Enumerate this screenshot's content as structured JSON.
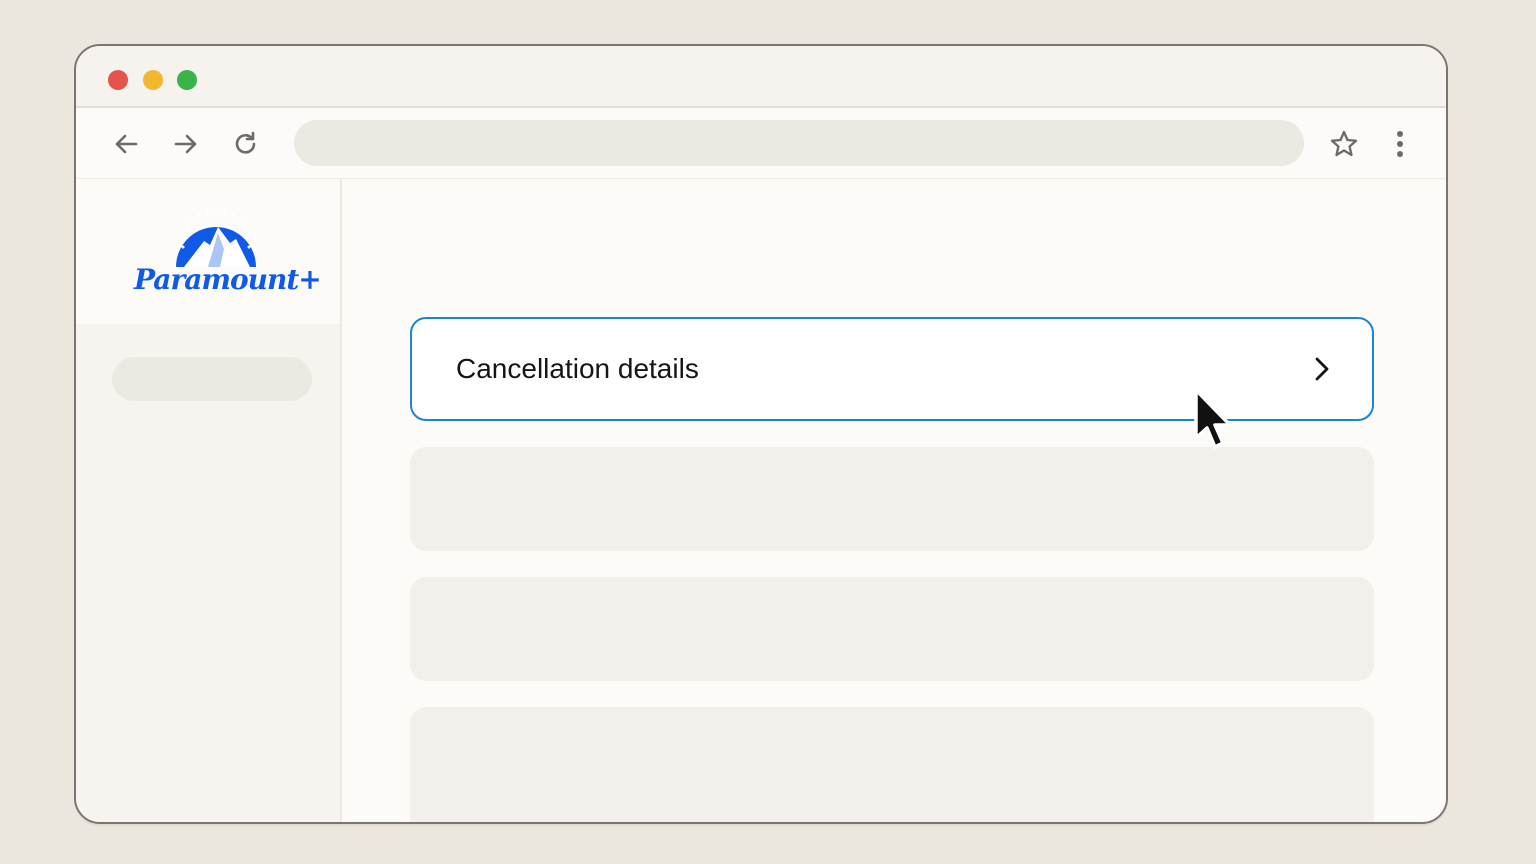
{
  "browser": {
    "window_controls": [
      "close",
      "minimize",
      "maximize"
    ],
    "nav": {
      "back_icon": "arrow-left-icon",
      "forward_icon": "arrow-right-icon",
      "reload_icon": "reload-icon",
      "bookmark_icon": "star-icon",
      "menu_icon": "kebab-menu-icon"
    },
    "address": {
      "value": "",
      "placeholder": ""
    }
  },
  "brand": {
    "name": "Paramount+",
    "color": "#0f5ae6"
  },
  "main": {
    "cards": [
      {
        "label": "Cancellation details",
        "highlighted": true,
        "accent": "#1a84d6"
      }
    ]
  }
}
